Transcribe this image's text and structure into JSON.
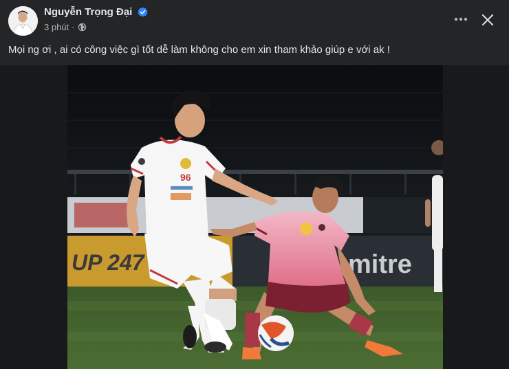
{
  "post": {
    "author": "Nguyễn Trọng Đại",
    "time": "3 phút",
    "separator": "·",
    "privacy_icon": "globe-icon",
    "verified_icon": "verified-badge-icon",
    "text": "Mọi ng ơi , ai có công việc gì tốt dễ làm không cho em xin tham khảo giúp e với ak !"
  },
  "header_actions": {
    "more_icon": "more-options-icon",
    "close_icon": "close-icon"
  },
  "photo": {
    "jersey_number": "96",
    "ad_board_left": "UP 247",
    "ad_board_right": "mitre"
  },
  "colors": {
    "background": "#242526",
    "text": "#e4e6eb",
    "secondary_text": "#b0b3b8",
    "verified": "#2d88ff"
  }
}
